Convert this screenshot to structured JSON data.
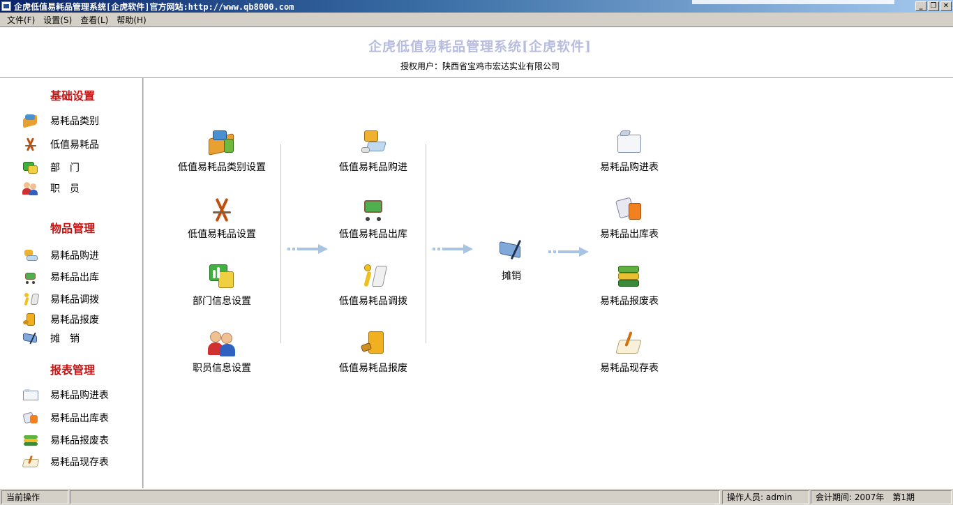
{
  "window": {
    "title": "企虎低值易耗品管理系统[企虎软件]官方网站:http://www.qb8000.com",
    "buttons": [
      "_",
      "❐",
      "✕"
    ]
  },
  "menubar": [
    "文件(F)",
    "设置(S)",
    "查看(L)",
    "帮助(H)"
  ],
  "header": {
    "title": "企虎低值易耗品管理系统[企虎软件]",
    "licensed_user": "授权用户：陕西省宝鸡市宏达实业有限公司"
  },
  "sidebar": {
    "sections": [
      {
        "title": "基础设置",
        "items": [
          {
            "label": "易耗品类别",
            "icon": "category-books-icon"
          },
          {
            "label": "低值易耗品",
            "icon": "drafting-compass-icon"
          },
          {
            "label": "部　门",
            "icon": "department-chart-icon"
          },
          {
            "label": "职　员",
            "icon": "employees-icon"
          }
        ]
      },
      {
        "title": "物品管理",
        "items": [
          {
            "label": "易耗品购进",
            "icon": "purchase-icon"
          },
          {
            "label": "易耗品出库",
            "icon": "shopping-cart-icon"
          },
          {
            "label": "易耗品调拨",
            "icon": "transfer-runner-icon"
          },
          {
            "label": "易耗品报废",
            "icon": "scrap-icon"
          },
          {
            "label": "摊　销",
            "icon": "amortize-icon"
          }
        ]
      },
      {
        "title": "报表管理",
        "items": [
          {
            "label": "易耗品购进表",
            "icon": "purchase-report-icon"
          },
          {
            "label": "易耗品出库表",
            "icon": "outbound-report-icon"
          },
          {
            "label": "易耗品报废表",
            "icon": "scrap-report-icon"
          },
          {
            "label": "易耗品现存表",
            "icon": "stock-report-icon"
          }
        ]
      }
    ]
  },
  "flow": {
    "col1": [
      "低值易耗品类别设置",
      "低值易耗品设置",
      "部门信息设置",
      "职员信息设置"
    ],
    "col2": [
      "低值易耗品购进",
      "低值易耗品出库",
      "低值易耗品调拨",
      "低值易耗品报废"
    ],
    "col3": [
      "摊销"
    ],
    "col4": [
      "易耗品购进表",
      "易耗品出库表",
      "易耗品报废表",
      "易耗品现存表"
    ]
  },
  "statusbar": {
    "current_op": "当前操作",
    "operator": "操作人员: admin",
    "period": "会计期间: 2007年　第1期"
  },
  "colors": {
    "section_title": "#cc1111",
    "header_title": "#b8bde0",
    "arrow": "#a9c4e2"
  }
}
